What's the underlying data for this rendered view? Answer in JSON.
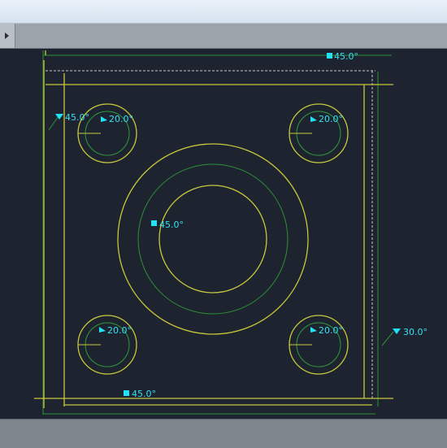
{
  "drawing": {
    "dimensions": {
      "top_chamfer": "45.0°",
      "top_left_chamfer": "45.0°",
      "hole_top_left": "20.0°",
      "hole_top_right": "20.0°",
      "center_bore": "45.0°",
      "hole_bottom_left": "20.0°",
      "hole_bottom_right": "20.0°",
      "right_edge": "30.0°",
      "bottom_chamfer": "45.0°"
    }
  },
  "colors": {
    "background": "#1d2430",
    "geometry": "#c8c83c",
    "construction": "#2f9a3a",
    "dimension_text": "#37e0f2"
  }
}
